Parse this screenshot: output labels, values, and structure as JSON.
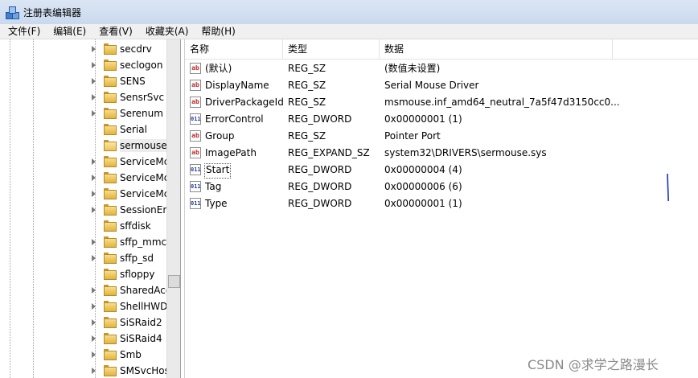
{
  "window": {
    "title": "注册表编辑器",
    "icon": "registry-editor-icon"
  },
  "menu": [
    {
      "id": "file",
      "label": "文件(F)"
    },
    {
      "id": "edit",
      "label": "编辑(E)"
    },
    {
      "id": "view",
      "label": "查看(V)"
    },
    {
      "id": "favorites",
      "label": "收藏夹(A)"
    },
    {
      "id": "help",
      "label": "帮助(H)"
    }
  ],
  "tree": {
    "selected": "sermouse",
    "items": [
      {
        "label": "secdrv",
        "expandable": true
      },
      {
        "label": "seclogon",
        "expandable": true
      },
      {
        "label": "SENS",
        "expandable": true
      },
      {
        "label": "SensrSvc",
        "expandable": true
      },
      {
        "label": "Serenum",
        "expandable": true
      },
      {
        "label": "Serial",
        "expandable": false
      },
      {
        "label": "sermouse",
        "expandable": false
      },
      {
        "label": "ServiceMc",
        "expandable": true
      },
      {
        "label": "ServiceMc",
        "expandable": true
      },
      {
        "label": "ServiceMc",
        "expandable": true
      },
      {
        "label": "SessionEn",
        "expandable": true
      },
      {
        "label": "sffdisk",
        "expandable": false
      },
      {
        "label": "sffp_mmc",
        "expandable": true
      },
      {
        "label": "sffp_sd",
        "expandable": true
      },
      {
        "label": "sfloppy",
        "expandable": false
      },
      {
        "label": "SharedAcc",
        "expandable": true
      },
      {
        "label": "ShellHWD",
        "expandable": true
      },
      {
        "label": "SiSRaid2",
        "expandable": true
      },
      {
        "label": "SiSRaid4",
        "expandable": true
      },
      {
        "label": "Smb",
        "expandable": true
      },
      {
        "label": "SMSvcHos",
        "expandable": true
      }
    ]
  },
  "list": {
    "columns": {
      "name": "名称",
      "type": "类型",
      "data": "数据"
    },
    "rows": [
      {
        "kind": "sz",
        "name": "(默认)",
        "type": "REG_SZ",
        "data": "(数值未设置)"
      },
      {
        "kind": "sz",
        "name": "DisplayName",
        "type": "REG_SZ",
        "data": "Serial Mouse Driver"
      },
      {
        "kind": "sz",
        "name": "DriverPackageId",
        "type": "REG_SZ",
        "data": "msmouse.inf_amd64_neutral_7a5f47d3150cc0..."
      },
      {
        "kind": "dw",
        "name": "ErrorControl",
        "type": "REG_DWORD",
        "data": "0x00000001 (1)"
      },
      {
        "kind": "sz",
        "name": "Group",
        "type": "REG_SZ",
        "data": "Pointer Port"
      },
      {
        "kind": "sz",
        "name": "ImagePath",
        "type": "REG_EXPAND_SZ",
        "data": "system32\\DRIVERS\\sermouse.sys"
      },
      {
        "kind": "dw",
        "name": "Start",
        "type": "REG_DWORD",
        "data": "0x00000004 (4)",
        "focused": true
      },
      {
        "kind": "dw",
        "name": "Tag",
        "type": "REG_DWORD",
        "data": "0x00000006 (6)"
      },
      {
        "kind": "dw",
        "name": "Type",
        "type": "REG_DWORD",
        "data": "0x00000001 (1)"
      }
    ],
    "icon_labels": {
      "sz": "ab",
      "dw": "011"
    }
  },
  "annotation": {
    "color": "#1a2fc4"
  },
  "watermark": "CSDN @求学之路漫长"
}
